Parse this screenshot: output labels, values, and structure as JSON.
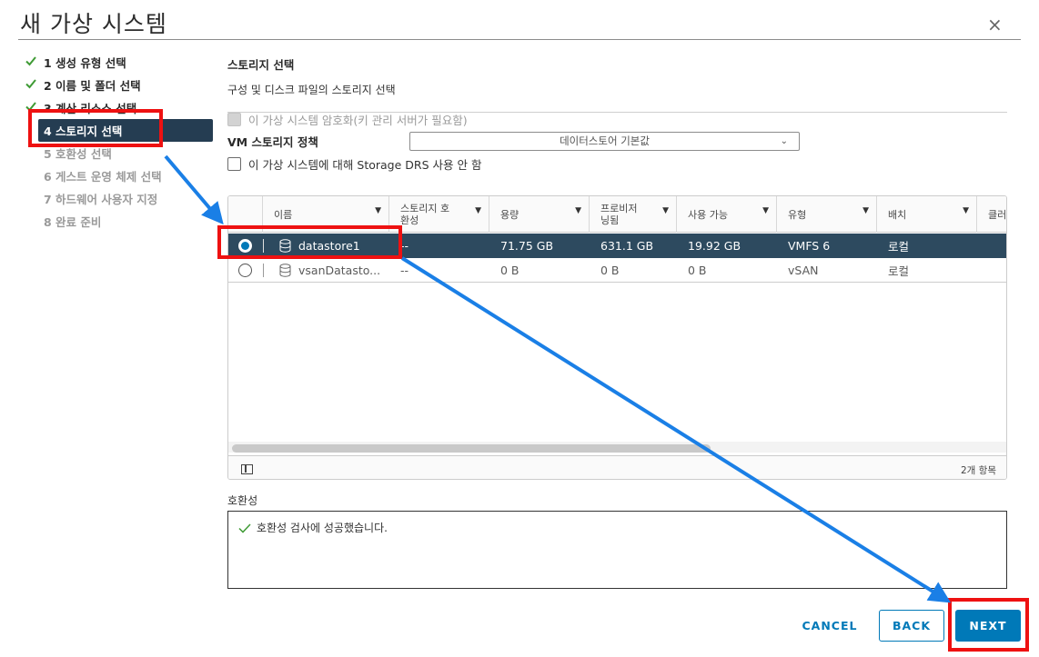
{
  "dialog": {
    "title": "새 가상 시스템",
    "close_glyph": "×"
  },
  "steps": [
    {
      "label": "1 생성 유형 선택",
      "state": "done"
    },
    {
      "label": "2 이름 및 폴더 선택",
      "state": "done"
    },
    {
      "label": "3 계산 리소스 선택",
      "state": "done"
    },
    {
      "label": "4 스토리지 선택",
      "state": "active"
    },
    {
      "label": "5 호환성 선택",
      "state": "todo"
    },
    {
      "label": "6 게스트 운영 체제 선택",
      "state": "todo"
    },
    {
      "label": "7 하드웨어 사용자 지정",
      "state": "todo"
    },
    {
      "label": "8 완료 준비",
      "state": "todo"
    }
  ],
  "storage": {
    "title": "스토리지 선택",
    "subtitle": "구성 및 디스크 파일의 스토리지 선택",
    "encrypt_label": "이 가상 시스템 암호화(키 관리 서버가 필요함)",
    "policy_label": "VM 스토리지 정책",
    "policy_value": "데이터스토어 기본값",
    "drs_label": "이 가상 시스템에 대해 Storage DRS 사용 안 함"
  },
  "grid": {
    "columns": [
      "이름",
      "스토리지 호환성",
      "용량",
      "프로비저닝됨",
      "사용 가능",
      "유형",
      "배치",
      "클러"
    ],
    "columns_display": [
      "이름",
      "스토리지 호\n환성",
      "용량",
      "프로비저\n닝됨",
      "사용 가능",
      "유형",
      "배치",
      "클러"
    ],
    "rows": [
      {
        "name": "datastore1",
        "compat": "--",
        "capacity": "71.75 GB",
        "provisioned": "631.1 GB",
        "free": "19.92 GB",
        "type": "VMFS 6",
        "placement": "로컬",
        "selected": true
      },
      {
        "name": "vsanDatasto...",
        "compat": "--",
        "capacity": "0 B",
        "provisioned": "0 B",
        "free": "0 B",
        "type": "vSAN",
        "placement": "로컬",
        "selected": false
      }
    ],
    "count": "2개 항목"
  },
  "compatibility": {
    "label": "호환성",
    "message": "호환성 검사에 성공했습니다."
  },
  "buttons": {
    "cancel": "CANCEL",
    "back": "BACK",
    "next": "NEXT"
  },
  "colors": {
    "accent": "#0079b8",
    "active_step": "#253d52",
    "selected_row": "#2d4a5f",
    "annotation_red": "#ee1111",
    "annotation_arrow": "#1a7fe6"
  }
}
